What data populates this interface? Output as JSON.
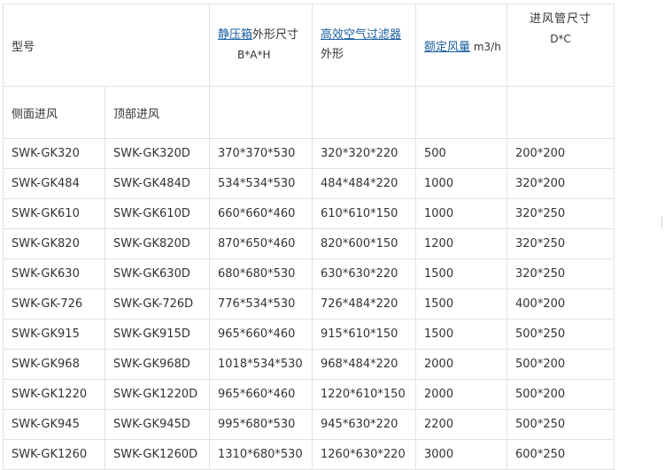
{
  "header": {
    "model": "型号",
    "plenum_link": "静压箱",
    "plenum_rest": "外形尺寸",
    "plenum_dims": "B*A*H",
    "hepa_link": "高效空气过滤器",
    "hepa_rest": "外形",
    "airflow_link": "额定风量",
    "airflow_unit": " m3/h",
    "duct_title": "进风管尺寸",
    "duct_dims": "D*C"
  },
  "subheader": {
    "side_inlet": "侧面进风",
    "top_inlet": "顶部进风"
  },
  "rows": [
    [
      "SWK-GK320",
      "SWK-GK320D",
      "370*370*530",
      "320*320*220",
      "500",
      "200*200"
    ],
    [
      "SWK-GK484",
      "SWK-GK484D",
      "534*534*530",
      "484*484*220",
      "1000",
      "320*200"
    ],
    [
      "SWK-GK610",
      "SWK-GK610D",
      "660*660*460",
      "610*610*150",
      "1000",
      "320*250"
    ],
    [
      "SWK-GK820",
      "SWK-GK820D",
      "870*650*460",
      "820*600*150",
      "1200",
      "320*250"
    ],
    [
      "SWK-GK630",
      "SWK-GK630D",
      "680*680*530",
      "630*630*220",
      "1500",
      "320*250"
    ],
    [
      "SWK-GK-726",
      "SWK-GK-726D",
      "776*534*530",
      "726*484*220",
      "1500",
      "400*200"
    ],
    [
      "SWK-GK915",
      "SWK-GK915D",
      "965*660*460",
      "915*610*150",
      "1500",
      "500*250"
    ],
    [
      "SWK-GK968",
      "SWK-GK968D",
      "1018*534*530",
      "968*484*220",
      "2000",
      "500*200"
    ],
    [
      "SWK-GK1220",
      "SWK-GK1220D",
      "965*660*460",
      "1220*610*150",
      "2000",
      "500*200"
    ],
    [
      "SWK-GK945",
      "SWK-GK945D",
      "995*680*530",
      "945*630*220",
      "2200",
      "500*250"
    ],
    [
      "SWK-GK1260",
      "SWK-GK1260D",
      "1310*680*530",
      "1260*630*220",
      "3000",
      "600*250"
    ]
  ],
  "colors": {
    "link": "#1a5fa0",
    "border": "#e2e2e2",
    "text": "#333333"
  }
}
